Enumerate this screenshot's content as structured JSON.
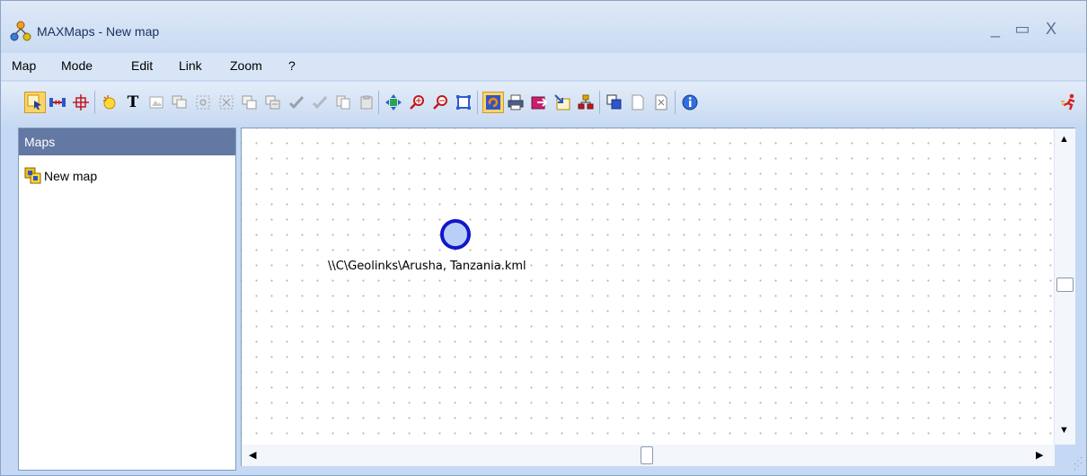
{
  "window": {
    "title": "MAXMaps - New map",
    "controls": {
      "minimize": "_",
      "maximize": "▭",
      "close": "X"
    }
  },
  "menu": [
    "Map",
    "Mode",
    "Edit",
    "Link",
    "Zoom",
    "?"
  ],
  "toolbar": {
    "buttons": [
      {
        "name": "select-mode-icon",
        "selected": true
      },
      {
        "name": "link-mode-icon"
      },
      {
        "name": "move-mode-icon"
      },
      {
        "name": "new-node-icon"
      },
      {
        "name": "text-icon"
      },
      {
        "name": "image-icon"
      },
      {
        "name": "group-icon"
      },
      {
        "name": "select-all-icon"
      },
      {
        "name": "select-area-icon"
      },
      {
        "name": "copy-node-icon"
      },
      {
        "name": "paste-node-icon"
      },
      {
        "name": "check-icon"
      },
      {
        "name": "validate-icon"
      },
      {
        "name": "copy-icon"
      },
      {
        "name": "paste-icon"
      },
      {
        "name": "fit-to-window-icon"
      },
      {
        "name": "zoom-in-icon"
      },
      {
        "name": "zoom-out-icon"
      },
      {
        "name": "actual-size-icon"
      },
      {
        "name": "refresh-icon",
        "selected": true
      },
      {
        "name": "print-icon"
      },
      {
        "name": "export-icon"
      },
      {
        "name": "import-icon"
      },
      {
        "name": "hierarchy-icon"
      },
      {
        "name": "bring-front-icon"
      },
      {
        "name": "blank-page-icon"
      },
      {
        "name": "close-page-icon"
      },
      {
        "name": "info-icon"
      },
      {
        "name": "run-icon"
      }
    ]
  },
  "sidebar": {
    "header": "Maps",
    "items": [
      {
        "label": "New map",
        "icon": "map-icon"
      }
    ]
  },
  "canvas": {
    "nodes": [
      {
        "label": "\\\\C\\Geolinks\\Arusha, Tanzania.kml",
        "shape": "circle"
      }
    ]
  },
  "colors": {
    "node_fill": "#b9cff7",
    "node_stroke": "#1217c9",
    "sidebar_header": "#6378a3",
    "toolbar_selected": "#f8d56b"
  }
}
